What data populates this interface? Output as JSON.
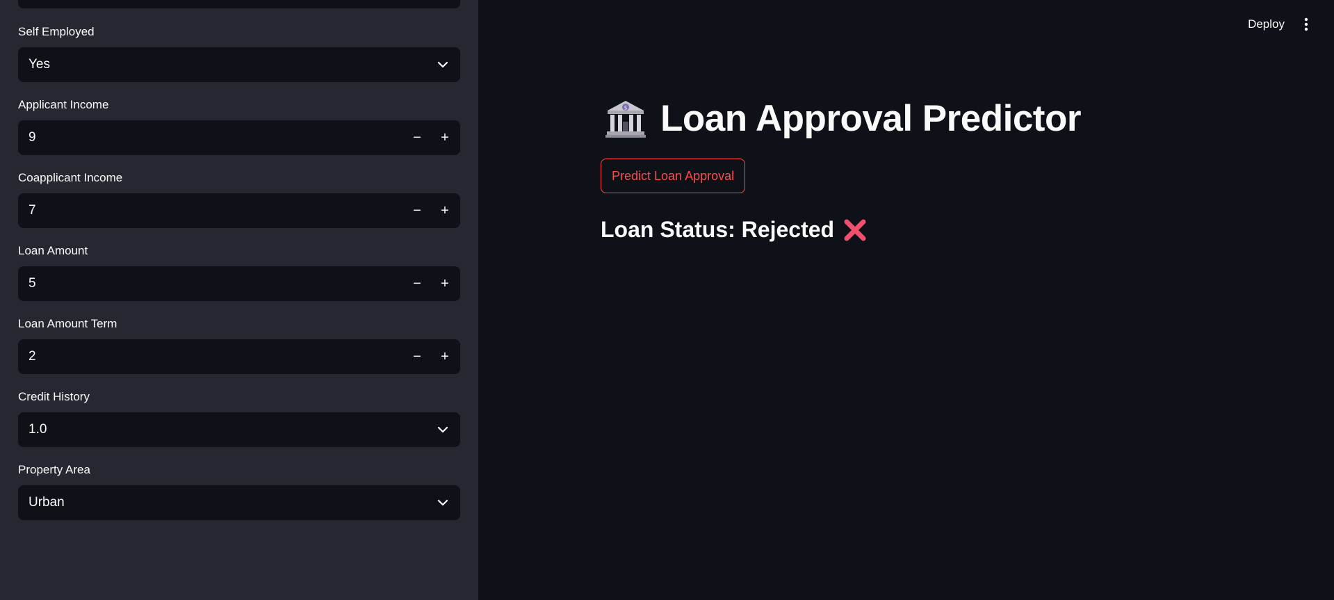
{
  "sidebar": {
    "self_employed": {
      "label": "Self Employed",
      "value": "Yes"
    },
    "applicant_income": {
      "label": "Applicant Income",
      "value": "9"
    },
    "coapplicant_income": {
      "label": "Coapplicant Income",
      "value": "7"
    },
    "loan_amount": {
      "label": "Loan Amount",
      "value": "5"
    },
    "loan_amount_term": {
      "label": "Loan Amount Term",
      "value": "2"
    },
    "credit_history": {
      "label": "Credit History",
      "value": "1.0"
    },
    "property_area": {
      "label": "Property Area",
      "value": "Urban"
    },
    "stepper_minus": "−",
    "stepper_plus": "+"
  },
  "header": {
    "deploy_label": "Deploy"
  },
  "main": {
    "title": "Loan Approval Predictor",
    "title_icon": "bank-icon",
    "predict_button": "Predict Loan Approval",
    "status": "Loan Status: Rejected",
    "status_icon": "cross-mark-icon"
  },
  "colors": {
    "sidebar_bg": "#262730",
    "main_bg": "#0e1117",
    "accent": "#ff4b4b",
    "text": "#fafafa"
  }
}
